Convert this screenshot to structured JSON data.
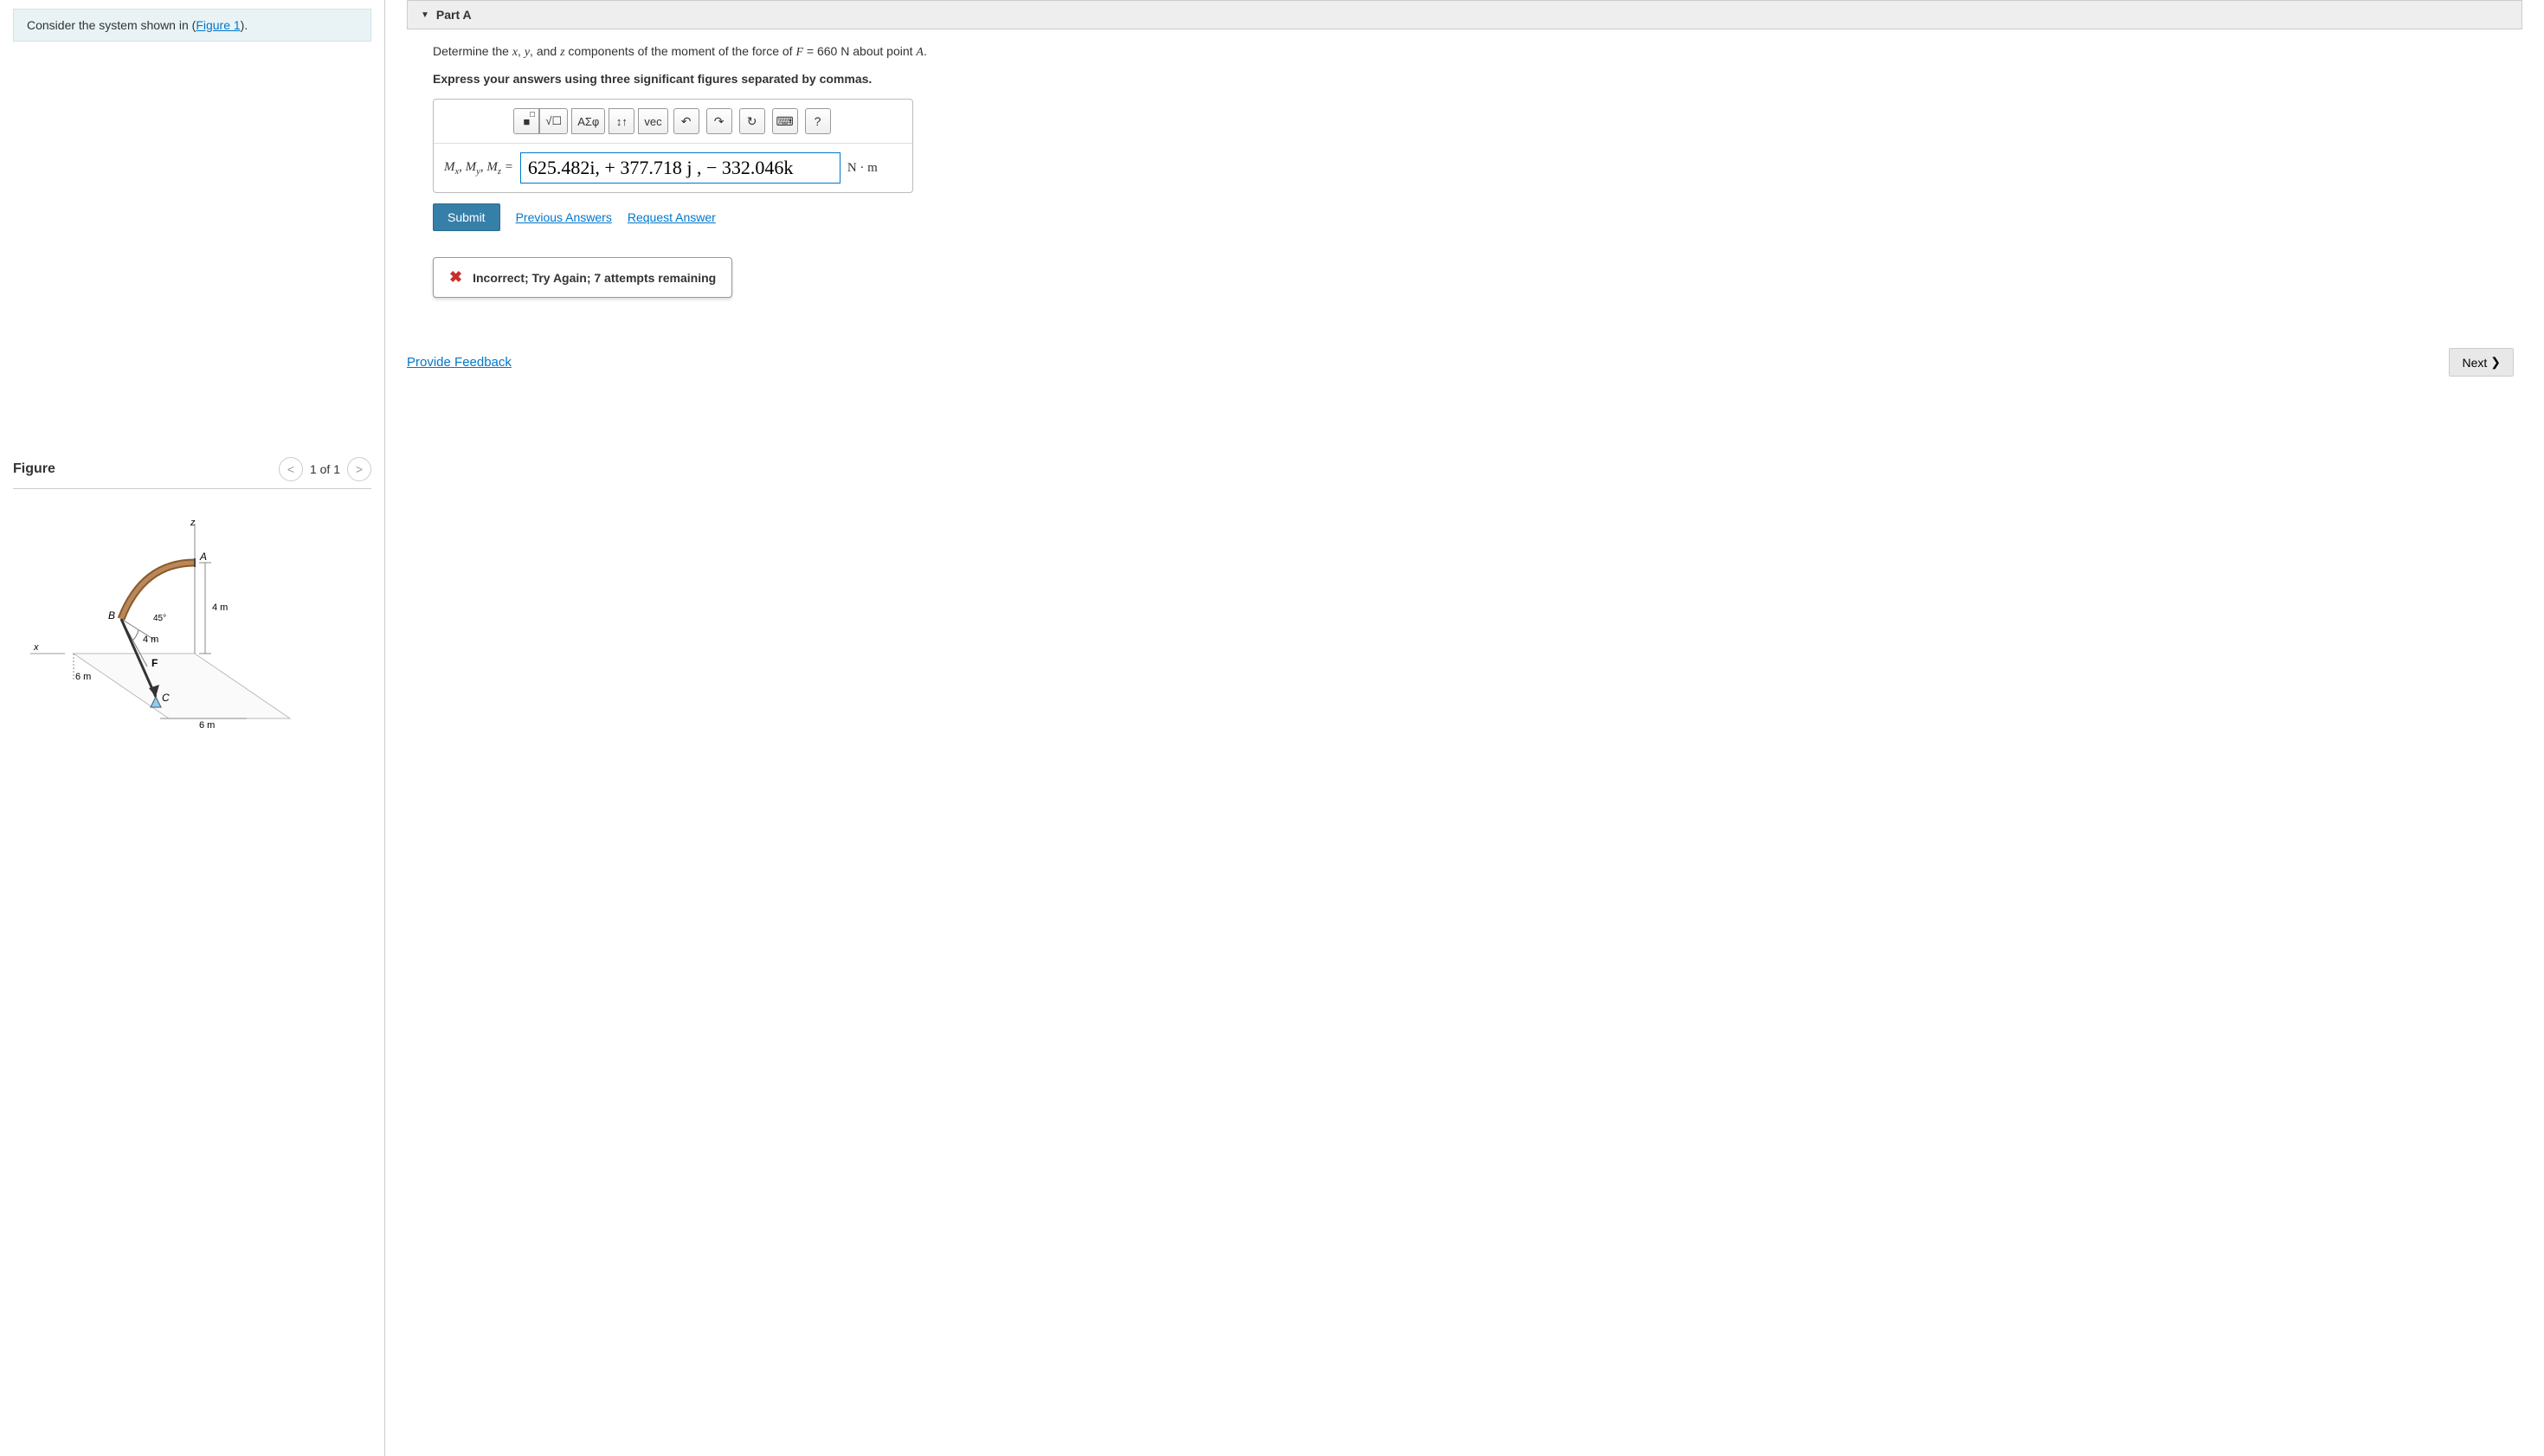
{
  "problem": {
    "prefix": "Consider the system shown in (",
    "link": "Figure 1",
    "suffix": ")."
  },
  "figure": {
    "title": "Figure",
    "counter": "1 of 1",
    "labels": {
      "z": "z",
      "x": "x",
      "A": "A",
      "B": "B",
      "C": "C",
      "F": "F",
      "angle": "45°",
      "d1": "4 m",
      "d2": "4 m",
      "d3": "6 m",
      "d4": "6 m"
    }
  },
  "part": {
    "title": "Part A",
    "question_prefix": "Determine the ",
    "var_x": "x",
    "comma1": ", ",
    "var_y": "y",
    "comma2": ", and ",
    "var_z": "z",
    "question_mid": " components of the moment of the force of ",
    "var_F": "F",
    "eq": " = 660  N",
    "question_suffix": " about point ",
    "var_A": "A",
    "period": ".",
    "instruction": "Express your answers using three significant figures separated by commas."
  },
  "toolbar": {
    "template": "■",
    "sqrt": "√☐",
    "greek": "ΑΣφ",
    "arrows": "↕↑",
    "vec": "vec",
    "undo": "↶",
    "redo": "↷",
    "reset": "↻",
    "keyboard": "⌨",
    "help": "?"
  },
  "answer": {
    "label_prefix": "M",
    "sub_x": "x",
    "sep": ", ",
    "sub_y": "y",
    "sub_z": "z",
    "equals": " = ",
    "value": "625.482i, + 377.718 j , − 332.046k",
    "unit": "N · m"
  },
  "controls": {
    "submit": "Submit",
    "previous": "Previous Answers",
    "request": "Request Answer"
  },
  "feedback": {
    "icon": "✖",
    "text": "Incorrect; Try Again; 7 attempts remaining"
  },
  "bottom": {
    "provide": "Provide Feedback",
    "next": "Next"
  }
}
